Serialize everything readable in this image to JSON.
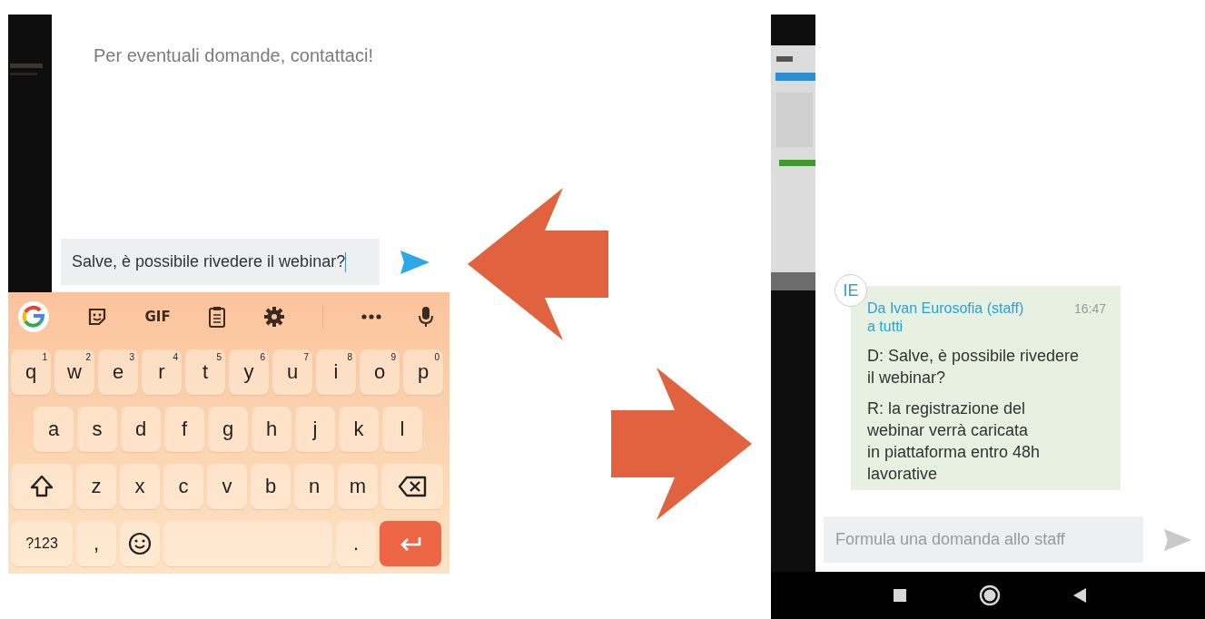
{
  "left_screen": {
    "message": "Per eventuali domande, contattaci!",
    "input": {
      "value": "Salve, è possibile rivedere il webinar?"
    },
    "send_enabled": true,
    "keyboard": {
      "toolbar": [
        {
          "kind": "google"
        },
        {
          "kind": "sticker"
        },
        {
          "kind": "gif",
          "label": "GIF"
        },
        {
          "kind": "clipboard"
        },
        {
          "kind": "settings"
        },
        {
          "kind": "more"
        },
        {
          "kind": "mic"
        }
      ],
      "rows": [
        {
          "keys": [
            {
              "kind": "char",
              "label": "q",
              "hint": "1"
            },
            {
              "kind": "char",
              "label": "w",
              "hint": "2"
            },
            {
              "kind": "char",
              "label": "e",
              "hint": "3"
            },
            {
              "kind": "char",
              "label": "r",
              "hint": "4"
            },
            {
              "kind": "char",
              "label": "t",
              "hint": "5"
            },
            {
              "kind": "char",
              "label": "y",
              "hint": "6"
            },
            {
              "kind": "char",
              "label": "u",
              "hint": "7"
            },
            {
              "kind": "char",
              "label": "i",
              "hint": "8"
            },
            {
              "kind": "char",
              "label": "o",
              "hint": "9"
            },
            {
              "kind": "char",
              "label": "p",
              "hint": "0"
            }
          ]
        },
        {
          "keys": [
            {
              "kind": "char",
              "label": "a"
            },
            {
              "kind": "char",
              "label": "s"
            },
            {
              "kind": "char",
              "label": "d"
            },
            {
              "kind": "char",
              "label": "f"
            },
            {
              "kind": "char",
              "label": "g"
            },
            {
              "kind": "char",
              "label": "h"
            },
            {
              "kind": "char",
              "label": "j"
            },
            {
              "kind": "char",
              "label": "k"
            },
            {
              "kind": "char",
              "label": "l"
            }
          ]
        },
        {
          "keys": [
            {
              "kind": "shift"
            },
            {
              "kind": "char",
              "label": "z"
            },
            {
              "kind": "char",
              "label": "x"
            },
            {
              "kind": "char",
              "label": "c"
            },
            {
              "kind": "char",
              "label": "v"
            },
            {
              "kind": "char",
              "label": "b"
            },
            {
              "kind": "char",
              "label": "n"
            },
            {
              "kind": "char",
              "label": "m"
            },
            {
              "kind": "backspace"
            }
          ]
        },
        {
          "keys": [
            {
              "kind": "symbols",
              "label": "?123"
            },
            {
              "kind": "char",
              "label": ","
            },
            {
              "kind": "emoji"
            },
            {
              "kind": "space"
            },
            {
              "kind": "char",
              "label": "."
            },
            {
              "kind": "enter"
            }
          ]
        }
      ]
    }
  },
  "arrows": [
    {
      "kind": "left"
    },
    {
      "kind": "right"
    }
  ],
  "right_screen": {
    "message": {
      "avatar": "IE",
      "sender": "Da Ivan Eurosofia (staff)",
      "recipient": "a tutti",
      "time": "16:47",
      "question": "D: Salve, è possibile rivedere\nil webinar?",
      "answer": "R: la registrazione del\nwebinar verrà caricata\nin piattaforma entro 48h\nlavorative"
    },
    "input": {
      "placeholder": "Formula una domanda allo staff"
    },
    "send_enabled": false,
    "nav_bar": [
      {
        "kind": "recents"
      },
      {
        "kind": "home"
      },
      {
        "kind": "back"
      }
    ]
  }
}
